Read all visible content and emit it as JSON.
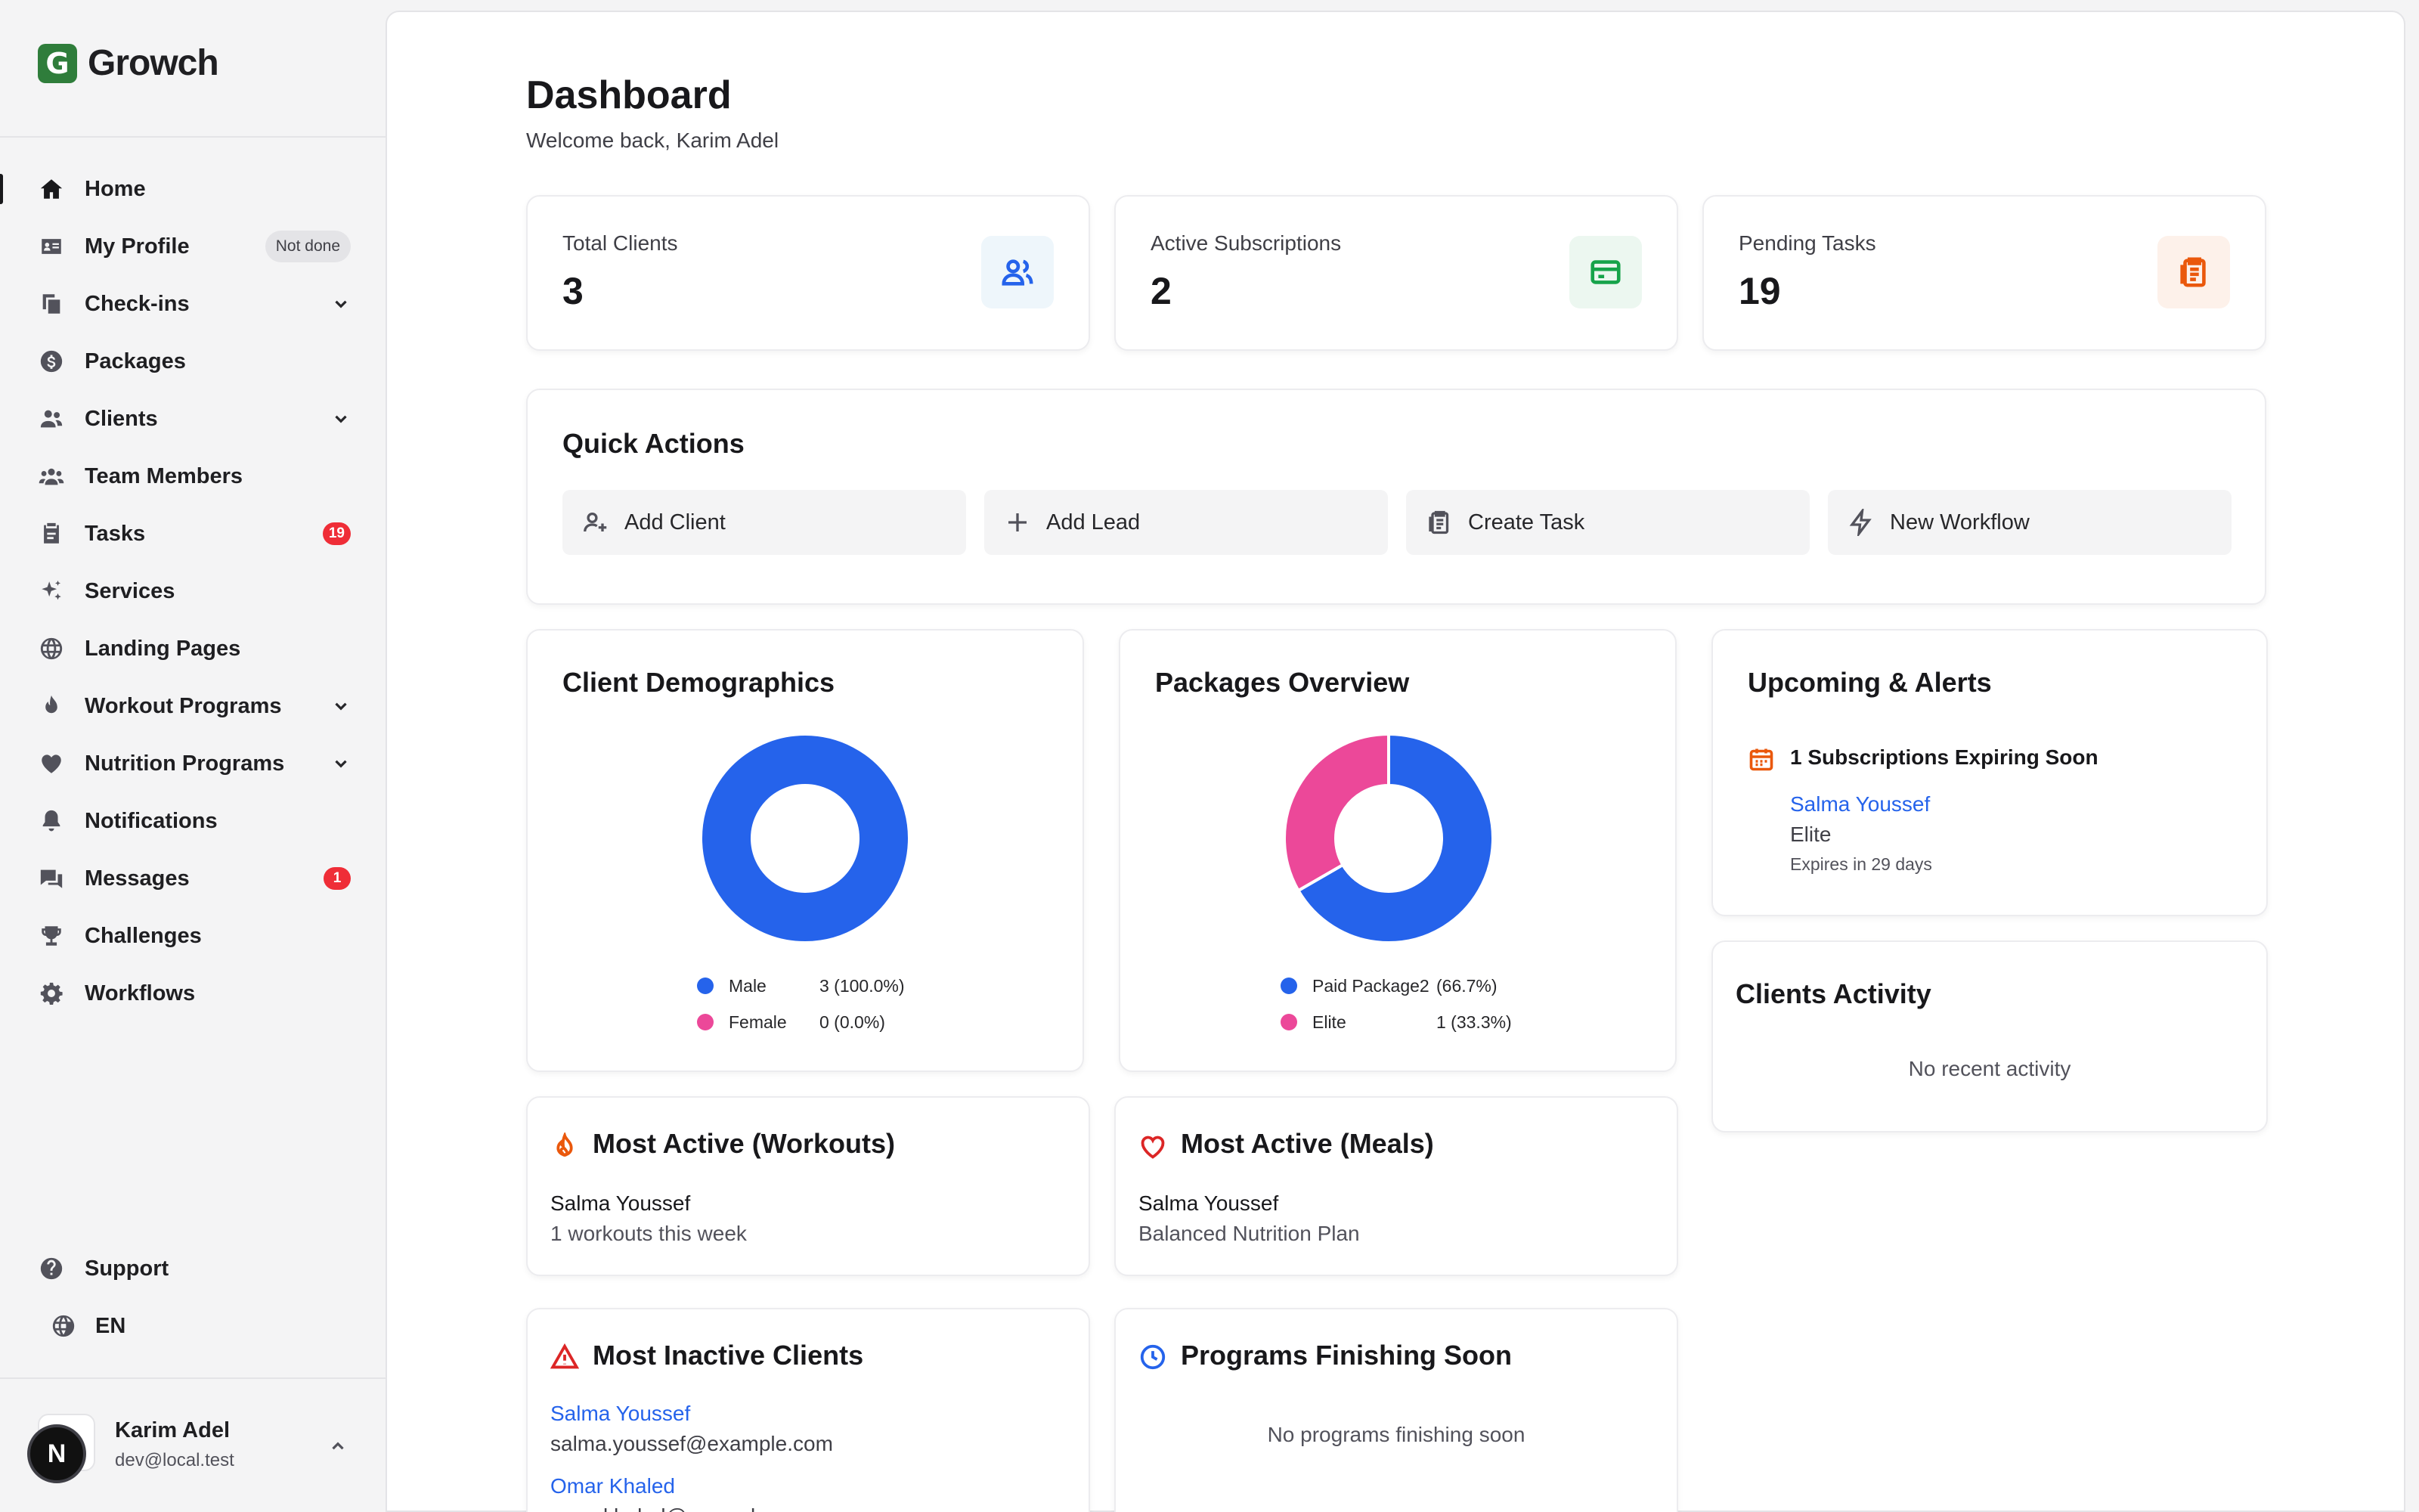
{
  "brand": {
    "logo_letter": "G",
    "name": "Growch"
  },
  "sidebar": {
    "items": [
      {
        "label": "Home",
        "icon": "home-icon"
      },
      {
        "label": "My Profile",
        "icon": "profile-card-icon",
        "badge": "Not done"
      },
      {
        "label": "Check-ins",
        "icon": "check-ins-icon"
      },
      {
        "label": "Packages",
        "icon": "dollar-icon"
      },
      {
        "label": "Clients",
        "icon": "users-icon"
      },
      {
        "label": "Team Members",
        "icon": "team-icon"
      },
      {
        "label": "Tasks",
        "icon": "tasks-icon",
        "badge": "19"
      },
      {
        "label": "Services",
        "icon": "sparkles-icon"
      },
      {
        "label": "Landing Pages",
        "icon": "globe-icon"
      },
      {
        "label": "Workout Programs",
        "icon": "flame-icon"
      },
      {
        "label": "Nutrition Programs",
        "icon": "heart-icon"
      },
      {
        "label": "Notifications",
        "icon": "bell-icon"
      },
      {
        "label": "Messages",
        "icon": "chat-icon",
        "badge": "1"
      },
      {
        "label": "Challenges",
        "icon": "trophy-icon"
      },
      {
        "label": "Workflows",
        "icon": "gear-icon"
      }
    ],
    "support": "Support",
    "language": "EN",
    "user": {
      "name": "Karim Adel",
      "email": "dev@local.test",
      "initial": "N"
    }
  },
  "header": {
    "title": "Dashboard",
    "subtitle": "Welcome back, Karim Adel"
  },
  "stats": [
    {
      "label": "Total Clients",
      "value": "3",
      "icon": "users-icon",
      "color": "#2563eb",
      "bg": "#eef6fb"
    },
    {
      "label": "Active Subscriptions",
      "value": "2",
      "icon": "credit-card-icon",
      "color": "#16a34a",
      "bg": "#ecf7f0"
    },
    {
      "label": "Pending Tasks",
      "value": "19",
      "icon": "clipboard-icon",
      "color": "#ea580c",
      "bg": "#fdf1ea"
    }
  ],
  "quick_actions": {
    "title": "Quick Actions",
    "buttons": [
      {
        "label": "Add Client",
        "icon": "user-plus-icon"
      },
      {
        "label": "Add Lead",
        "icon": "plus-icon"
      },
      {
        "label": "Create Task",
        "icon": "clipboard-icon"
      },
      {
        "label": "New Workflow",
        "icon": "zap-icon"
      }
    ]
  },
  "demographics": {
    "title": "Client Demographics",
    "legend": [
      {
        "name": "Male",
        "value": "3 (100.0%)",
        "color": "#2563eb"
      },
      {
        "name": "Female",
        "value": "0 (0.0%)",
        "color": "#ec4899"
      }
    ]
  },
  "packages": {
    "title": "Packages Overview",
    "legend": [
      {
        "name": "Paid Package2",
        "value": "(66.7%)",
        "color": "#2563eb"
      },
      {
        "name": "Elite",
        "value": "1 (33.3%)",
        "color": "#ec4899"
      }
    ]
  },
  "chart_data": [
    {
      "type": "pie",
      "title": "Client Demographics",
      "categories": [
        "Male",
        "Female"
      ],
      "values": [
        3,
        0
      ]
    },
    {
      "type": "pie",
      "title": "Packages Overview",
      "categories": [
        "Paid Package2",
        "Elite"
      ],
      "values": [
        2,
        1
      ]
    }
  ],
  "alerts": {
    "title": "Upcoming & Alerts",
    "heading": "1 Subscriptions Expiring Soon",
    "client": "Salma Youssef",
    "plan": "Elite",
    "expires": "Expires in 29 days"
  },
  "activity": {
    "title": "Clients Activity",
    "empty": "No recent activity"
  },
  "most_active_workouts": {
    "title": "Most Active (Workouts)",
    "name": "Salma Youssef",
    "detail": "1 workouts this week"
  },
  "most_active_meals": {
    "title": "Most Active (Meals)",
    "name": "Salma Youssef",
    "detail": "Balanced Nutrition Plan"
  },
  "inactive": {
    "title": "Most Inactive Clients",
    "clients": [
      {
        "name": "Salma Youssef",
        "email": "salma.youssef@example.com"
      },
      {
        "name": "Omar Khaled",
        "email": "omar.khaled@example.com"
      }
    ]
  },
  "finishing": {
    "title": "Programs Finishing Soon",
    "empty": "No programs finishing soon"
  }
}
